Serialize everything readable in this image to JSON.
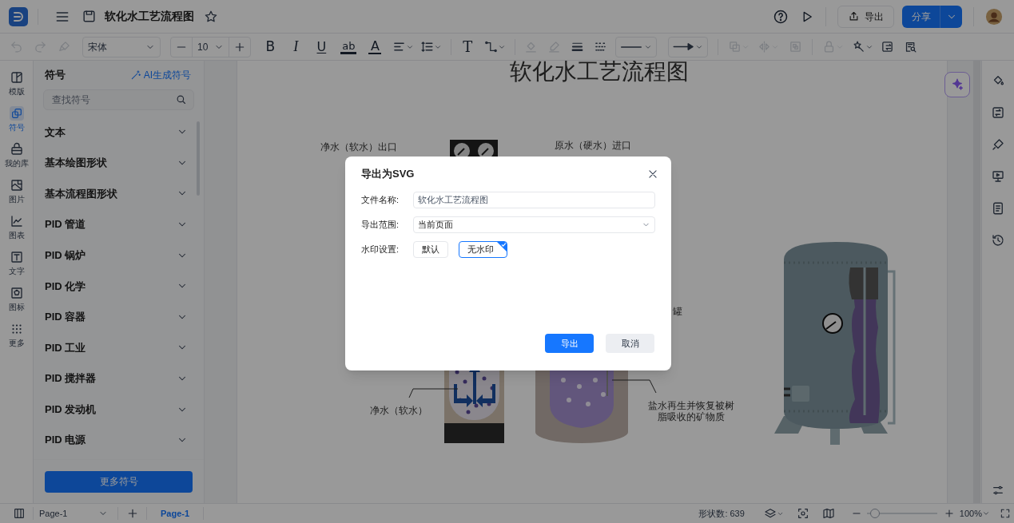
{
  "app": {
    "title": "软化水工艺流程图"
  },
  "header": {
    "export_button": "导出",
    "share_button": "分享"
  },
  "toolbar": {
    "font": "宋体",
    "font_size": "10",
    "text_tools": [
      {
        "kind": "bold",
        "label": "B"
      },
      {
        "kind": "italic",
        "label": "I"
      },
      {
        "kind": "underline",
        "label": "U"
      },
      {
        "kind": "highlight",
        "label": "ab"
      },
      {
        "kind": "font_color",
        "label": "A"
      }
    ],
    "text_tool": "T"
  },
  "left_rail": [
    {
      "kind": "template",
      "label": "模版",
      "selected": false
    },
    {
      "kind": "symbol",
      "label": "符号",
      "selected": true
    },
    {
      "kind": "library",
      "label": "我的库",
      "selected": false
    },
    {
      "kind": "image",
      "label": "图片",
      "selected": false
    },
    {
      "kind": "chart",
      "label": "图表",
      "selected": false
    },
    {
      "kind": "text",
      "label": "文字",
      "selected": false
    },
    {
      "kind": "icon",
      "label": "图标",
      "selected": false
    },
    {
      "kind": "more",
      "label": "更多",
      "selected": false
    }
  ],
  "symbol_panel": {
    "title": "符号",
    "ai_link": "AI生成符号",
    "search_placeholder": "查找符号",
    "categories": [
      "文本",
      "基本绘图形状",
      "基本流程图形状",
      "PID 管道",
      "PID 锅炉",
      "PID 化学",
      "PID 容器",
      "PID 工业",
      "PID 搅拌器",
      "PID 发动机",
      "PID 电源"
    ],
    "more_button": "更多符号"
  },
  "canvas": {
    "title": "软化水工艺流程图",
    "labels": [
      "净水（软水）出口",
      "原水（硬水）进口",
      "罐",
      "净水（软水）",
      "盐水再生并恢复被树脂吸收的矿物质"
    ]
  },
  "dialog": {
    "title": "导出为SVG",
    "fields": [
      {
        "kind": "text",
        "label": "文件名称:",
        "value": "软化水工艺流程图"
      },
      {
        "kind": "select",
        "label": "导出范围:",
        "value": "当前页面"
      },
      {
        "kind": "options",
        "label": "水印设置:",
        "options": [
          {
            "label": "默认",
            "selected": false
          },
          {
            "label": "无水印",
            "selected": true
          }
        ]
      }
    ],
    "buttons": [
      {
        "kind": "primary",
        "label": "导出"
      },
      {
        "kind": "secondary",
        "label": "取消"
      }
    ]
  },
  "status_bar": {
    "page_select": "Page-1",
    "page_tab": "Page-1",
    "shape_count": "形状数: 639",
    "zoom_slider": {
      "level": 0.12
    },
    "zoom": "100%"
  }
}
